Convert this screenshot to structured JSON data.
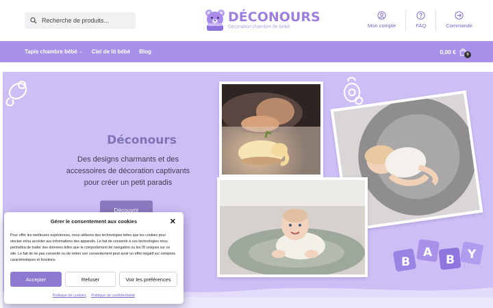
{
  "header": {
    "search_placeholder": "Recherche de produits...",
    "brand": "DÉCONOURS",
    "tagline": "Décoration chambre de bébé",
    "links": [
      {
        "label": "Mon compte",
        "icon": "user-icon"
      },
      {
        "label": "FAQ",
        "icon": "question-icon"
      },
      {
        "label": "Commande",
        "icon": "arrow-right-circle-icon"
      }
    ]
  },
  "nav": {
    "items": [
      {
        "label": "Tapis chambre bébé",
        "has_dropdown": true
      },
      {
        "label": "Ciel de lit bébé"
      },
      {
        "label": "Blog"
      }
    ],
    "cart_total": "0,00 €",
    "cart_count": "0"
  },
  "hero": {
    "title": "Déconours",
    "subtitle": "Des designs charmants et des accessoires de décoration captivants pour créer un petit paradis",
    "button": "Découvrir",
    "baby_blocks": [
      "B",
      "A",
      "B",
      "Y"
    ]
  },
  "cookie": {
    "title": "Gérer le consentement aux cookies",
    "text": "Pour offrir les meilleures expériences, nous utilisons des technologies telles que les cookies pour stocker et/ou accéder aux informations des appareils. Le fait de consentir à ces technologies nous permettra de traiter des données telles que le comportement de navigation ou les ID uniques sur ce site. Le fait de ne pas consentir ou de retirer son consentement peut avoir un effet négatif sur certaines caractéristiques et fonctions.",
    "accept": "Accepter",
    "refuse": "Refuser",
    "preferences": "Voir les préférences",
    "link_cookies": "Politique de cookies",
    "link_privacy": "Politique de confidentialité"
  },
  "colors": {
    "brand": "#9d7fe0",
    "nav_bg": "#a891ea",
    "hero_bg": "#cdbff6",
    "accept_btn": "#8e7ad0"
  }
}
